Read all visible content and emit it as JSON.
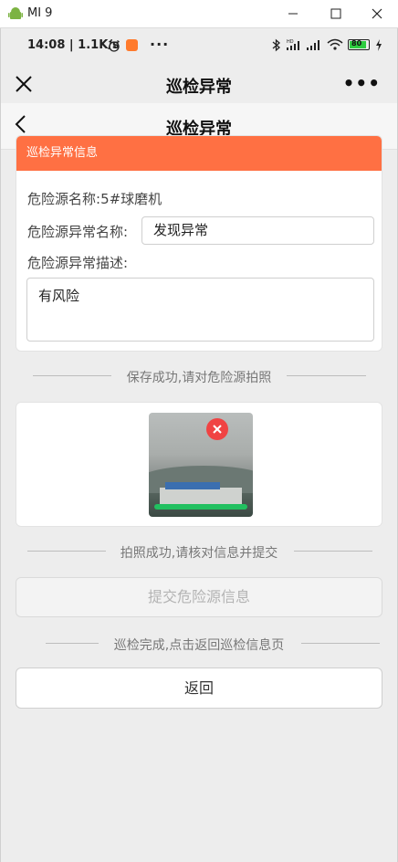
{
  "window": {
    "title": "MI 9"
  },
  "statusbar": {
    "time": "14:08 | 1.1K/s",
    "more": "···",
    "battery": "80"
  },
  "wechat_nav": {
    "title": "巡检异常",
    "more": "•••"
  },
  "page_header": {
    "title": "巡检异常"
  },
  "info_card": {
    "header": "巡检异常信息",
    "hazard_name_label": "危险源名称:",
    "hazard_name_value": "5#球磨机",
    "abnormal_name_label": "危险源异常名称:",
    "abnormal_name_value": "发现异常",
    "abnormal_desc_label": "危险源异常描述:",
    "abnormal_desc_value": "有风险"
  },
  "dividers": {
    "save_success": "保存成功,请对危险源拍照",
    "photo_success": "拍照成功,请核对信息并提交",
    "inspection_done": "巡检完成,点击返回巡检信息页"
  },
  "photo": {
    "upload_progress": 1.0
  },
  "buttons": {
    "submit": "提交危险源信息",
    "return": "返回"
  },
  "colors": {
    "accent": "#ff7043",
    "progress": "#21c060",
    "delete": "#f04343"
  }
}
